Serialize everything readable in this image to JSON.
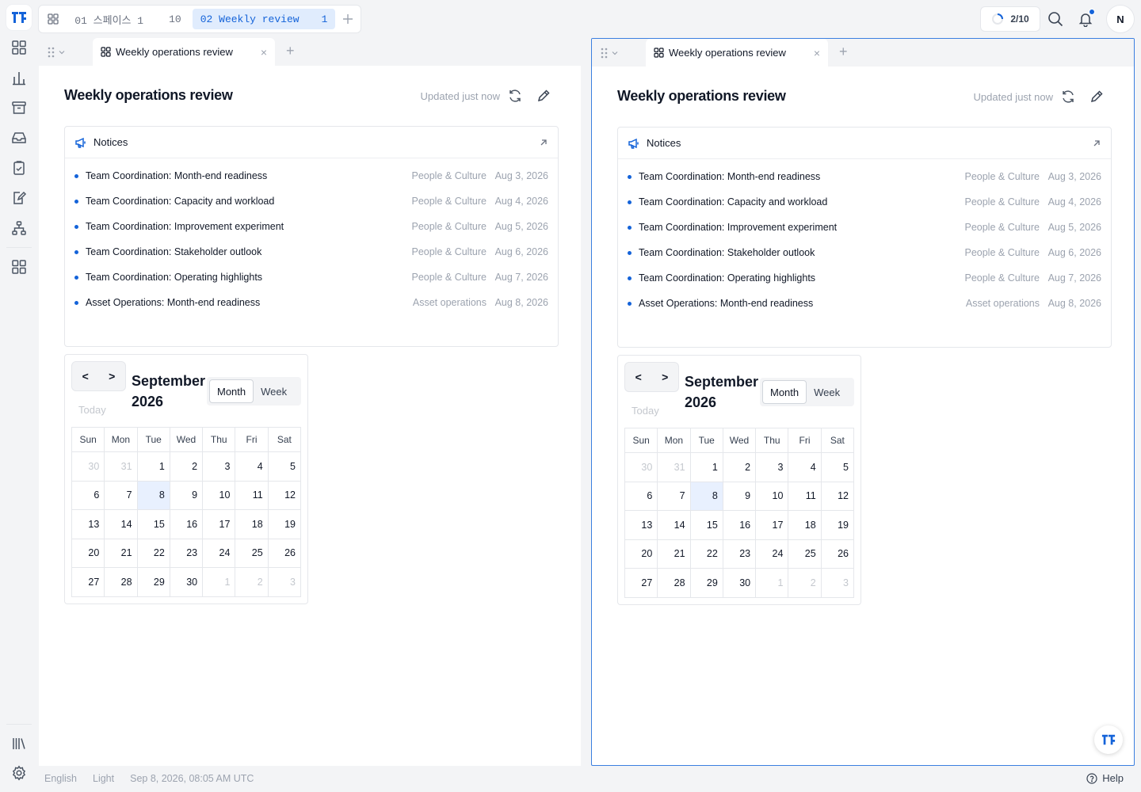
{
  "top": {
    "space_tabs": [
      {
        "label": "01 스페이스 1",
        "count": "10"
      },
      {
        "label": "02 Weekly review",
        "count": "1"
      }
    ],
    "progress": "2/10",
    "avatar": "N"
  },
  "panes": [
    {
      "tab_label": "Weekly operations review",
      "title": "Weekly operations review",
      "updated": "Updated just now",
      "notices": {
        "heading": "Notices",
        "items": [
          {
            "title": "Team Coordination: Month-end readiness",
            "category": "People & Culture",
            "date": "Aug 3, 2026"
          },
          {
            "title": "Team Coordination: Capacity and workload",
            "category": "People & Culture",
            "date": "Aug 4, 2026"
          },
          {
            "title": "Team Coordination: Improvement experiment",
            "category": "People & Culture",
            "date": "Aug 5, 2026"
          },
          {
            "title": "Team Coordination: Stakeholder outlook",
            "category": "People & Culture",
            "date": "Aug 6, 2026"
          },
          {
            "title": "Team Coordination: Operating highlights",
            "category": "People & Culture",
            "date": "Aug 7, 2026"
          },
          {
            "title": "Asset Operations: Month-end readiness",
            "category": "Asset operations",
            "date": "Aug 8, 2026"
          }
        ]
      },
      "calendar": {
        "month_line1": "September",
        "month_line2": "2026",
        "today": "Today",
        "prev": "<",
        "next": ">",
        "view_month": "Month",
        "view_week": "Week"
      }
    },
    {
      "tab_label": "Weekly operations review",
      "title": "Weekly operations review",
      "updated": "Updated just now",
      "notices": {
        "heading": "Notices",
        "items": [
          {
            "title": "Team Coordination: Month-end readiness",
            "category": "People & Culture",
            "date": "Aug 3, 2026"
          },
          {
            "title": "Team Coordination: Capacity and workload",
            "category": "People & Culture",
            "date": "Aug 4, 2026"
          },
          {
            "title": "Team Coordination: Improvement experiment",
            "category": "People & Culture",
            "date": "Aug 5, 2026"
          },
          {
            "title": "Team Coordination: Stakeholder outlook",
            "category": "People & Culture",
            "date": "Aug 6, 2026"
          },
          {
            "title": "Team Coordination: Operating highlights",
            "category": "People & Culture",
            "date": "Aug 7, 2026"
          },
          {
            "title": "Asset Operations: Month-end readiness",
            "category": "Asset operations",
            "date": "Aug 8, 2026"
          }
        ]
      },
      "calendar": {
        "month_line1": "September",
        "month_line2": "2026",
        "today": "Today",
        "prev": "<",
        "next": ">",
        "view_month": "Month",
        "view_week": "Week"
      }
    }
  ],
  "calendar_grid": {
    "weekdays": [
      "Sun",
      "Mon",
      "Tue",
      "Wed",
      "Thu",
      "Fri",
      "Sat"
    ],
    "weeks": [
      [
        "30",
        "31",
        "1",
        "2",
        "3",
        "4",
        "5"
      ],
      [
        "6",
        "7",
        "8",
        "9",
        "10",
        "11",
        "12"
      ],
      [
        "13",
        "14",
        "15",
        "16",
        "17",
        "18",
        "19"
      ],
      [
        "20",
        "21",
        "22",
        "23",
        "24",
        "25",
        "26"
      ],
      [
        "27",
        "28",
        "29",
        "30",
        "1",
        "2",
        "3"
      ]
    ],
    "outside_month": [
      [
        0,
        0
      ],
      [
        0,
        1
      ],
      [
        4,
        4
      ],
      [
        4,
        5
      ],
      [
        4,
        6
      ]
    ],
    "selected": [
      1,
      2
    ]
  },
  "footer": {
    "language": "English",
    "theme": "Light",
    "datetime": "Sep 8, 2026, 08:05 AM UTC",
    "help": "Help"
  },
  "colors": {
    "accent": "#1463d9",
    "selected_day": "#e8f0fe"
  }
}
